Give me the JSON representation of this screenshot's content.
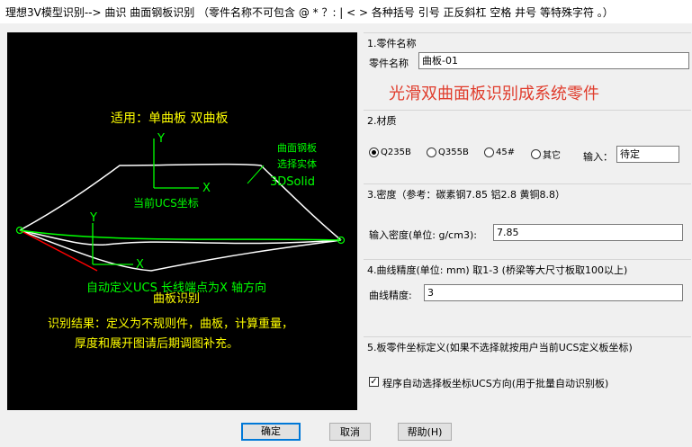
{
  "window": {
    "title": "理想3V模型识别--> 曲识 曲面钢板识别  （零件名称不可包含 @ * ？: |  < > 各种括号 引号 正反斜杠 空格 井号 等特殊字符 。）"
  },
  "preview": {
    "apply_text": "适用：单曲板 双曲板",
    "axis_y": "Y",
    "axis_x": "X",
    "ucs_label": "当前UCS坐标",
    "select_label_1": "曲面钢板",
    "select_label_2": "选择实体",
    "solid_label": "3DSolid",
    "auto_ucs_text": "自动定义UCS 长线端点为X 轴方向",
    "recognize_text": "曲板识别",
    "result_line_1": "识别结果：定义为不规则件，曲板，计算重量，",
    "result_line_2": "厚度和展开图请后期调图补充。",
    "colors": {
      "yellow": "#ffff00",
      "green": "#00ff00",
      "white": "#ffffff",
      "red": "#ff0000"
    }
  },
  "part_name": {
    "legend": "1.零件名称",
    "label": "零件名称",
    "value": "曲板-01",
    "banner": "光滑双曲面板识别成系统零件",
    "banner_color": "#e03c2c"
  },
  "material": {
    "legend": "2.材质",
    "options": [
      {
        "label": "Q235B",
        "selected": true
      },
      {
        "label": "Q355B",
        "selected": false
      },
      {
        "label": "45#",
        "selected": false
      },
      {
        "label": "其它",
        "selected": false
      }
    ],
    "input_label": "输入：",
    "input_value": "待定"
  },
  "density": {
    "legend": "3.密度（参考：碳素钢7.85  铝2.8 黄铜8.8）",
    "label": "输入密度(单位: g/cm3):",
    "value": "7.85"
  },
  "precision": {
    "legend": "4.曲线精度(单位: mm) 取1-3  (桥梁等大尺寸板取100以上)",
    "label": "曲线精度:",
    "value": "3"
  },
  "ucs": {
    "legend": "5.板零件坐标定义(如果不选择就按用户当前UCS定义板坐标)",
    "checkbox_label": "程序自动选择板坐标UCS方向(用于批量自动识别板)",
    "checked": true
  },
  "buttons": {
    "ok": "确定",
    "cancel": "取消",
    "help": "帮助(H)"
  }
}
